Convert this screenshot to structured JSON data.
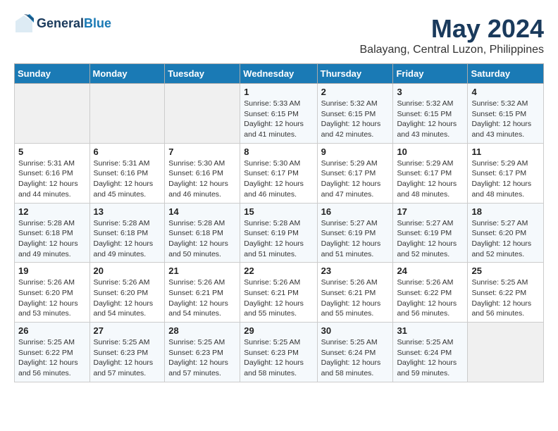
{
  "header": {
    "logo_line1": "General",
    "logo_line2": "Blue",
    "month": "May 2024",
    "location": "Balayang, Central Luzon, Philippines"
  },
  "weekdays": [
    "Sunday",
    "Monday",
    "Tuesday",
    "Wednesday",
    "Thursday",
    "Friday",
    "Saturday"
  ],
  "weeks": [
    [
      {
        "day": "",
        "info": ""
      },
      {
        "day": "",
        "info": ""
      },
      {
        "day": "",
        "info": ""
      },
      {
        "day": "1",
        "info": "Sunrise: 5:33 AM\nSunset: 6:15 PM\nDaylight: 12 hours\nand 41 minutes."
      },
      {
        "day": "2",
        "info": "Sunrise: 5:32 AM\nSunset: 6:15 PM\nDaylight: 12 hours\nand 42 minutes."
      },
      {
        "day": "3",
        "info": "Sunrise: 5:32 AM\nSunset: 6:15 PM\nDaylight: 12 hours\nand 43 minutes."
      },
      {
        "day": "4",
        "info": "Sunrise: 5:32 AM\nSunset: 6:15 PM\nDaylight: 12 hours\nand 43 minutes."
      }
    ],
    [
      {
        "day": "5",
        "info": "Sunrise: 5:31 AM\nSunset: 6:16 PM\nDaylight: 12 hours\nand 44 minutes."
      },
      {
        "day": "6",
        "info": "Sunrise: 5:31 AM\nSunset: 6:16 PM\nDaylight: 12 hours\nand 45 minutes."
      },
      {
        "day": "7",
        "info": "Sunrise: 5:30 AM\nSunset: 6:16 PM\nDaylight: 12 hours\nand 46 minutes."
      },
      {
        "day": "8",
        "info": "Sunrise: 5:30 AM\nSunset: 6:17 PM\nDaylight: 12 hours\nand 46 minutes."
      },
      {
        "day": "9",
        "info": "Sunrise: 5:29 AM\nSunset: 6:17 PM\nDaylight: 12 hours\nand 47 minutes."
      },
      {
        "day": "10",
        "info": "Sunrise: 5:29 AM\nSunset: 6:17 PM\nDaylight: 12 hours\nand 48 minutes."
      },
      {
        "day": "11",
        "info": "Sunrise: 5:29 AM\nSunset: 6:17 PM\nDaylight: 12 hours\nand 48 minutes."
      }
    ],
    [
      {
        "day": "12",
        "info": "Sunrise: 5:28 AM\nSunset: 6:18 PM\nDaylight: 12 hours\nand 49 minutes."
      },
      {
        "day": "13",
        "info": "Sunrise: 5:28 AM\nSunset: 6:18 PM\nDaylight: 12 hours\nand 49 minutes."
      },
      {
        "day": "14",
        "info": "Sunrise: 5:28 AM\nSunset: 6:18 PM\nDaylight: 12 hours\nand 50 minutes."
      },
      {
        "day": "15",
        "info": "Sunrise: 5:28 AM\nSunset: 6:19 PM\nDaylight: 12 hours\nand 51 minutes."
      },
      {
        "day": "16",
        "info": "Sunrise: 5:27 AM\nSunset: 6:19 PM\nDaylight: 12 hours\nand 51 minutes."
      },
      {
        "day": "17",
        "info": "Sunrise: 5:27 AM\nSunset: 6:19 PM\nDaylight: 12 hours\nand 52 minutes."
      },
      {
        "day": "18",
        "info": "Sunrise: 5:27 AM\nSunset: 6:20 PM\nDaylight: 12 hours\nand 52 minutes."
      }
    ],
    [
      {
        "day": "19",
        "info": "Sunrise: 5:26 AM\nSunset: 6:20 PM\nDaylight: 12 hours\nand 53 minutes."
      },
      {
        "day": "20",
        "info": "Sunrise: 5:26 AM\nSunset: 6:20 PM\nDaylight: 12 hours\nand 54 minutes."
      },
      {
        "day": "21",
        "info": "Sunrise: 5:26 AM\nSunset: 6:21 PM\nDaylight: 12 hours\nand 54 minutes."
      },
      {
        "day": "22",
        "info": "Sunrise: 5:26 AM\nSunset: 6:21 PM\nDaylight: 12 hours\nand 55 minutes."
      },
      {
        "day": "23",
        "info": "Sunrise: 5:26 AM\nSunset: 6:21 PM\nDaylight: 12 hours\nand 55 minutes."
      },
      {
        "day": "24",
        "info": "Sunrise: 5:26 AM\nSunset: 6:22 PM\nDaylight: 12 hours\nand 56 minutes."
      },
      {
        "day": "25",
        "info": "Sunrise: 5:25 AM\nSunset: 6:22 PM\nDaylight: 12 hours\nand 56 minutes."
      }
    ],
    [
      {
        "day": "26",
        "info": "Sunrise: 5:25 AM\nSunset: 6:22 PM\nDaylight: 12 hours\nand 56 minutes."
      },
      {
        "day": "27",
        "info": "Sunrise: 5:25 AM\nSunset: 6:23 PM\nDaylight: 12 hours\nand 57 minutes."
      },
      {
        "day": "28",
        "info": "Sunrise: 5:25 AM\nSunset: 6:23 PM\nDaylight: 12 hours\nand 57 minutes."
      },
      {
        "day": "29",
        "info": "Sunrise: 5:25 AM\nSunset: 6:23 PM\nDaylight: 12 hours\nand 58 minutes."
      },
      {
        "day": "30",
        "info": "Sunrise: 5:25 AM\nSunset: 6:24 PM\nDaylight: 12 hours\nand 58 minutes."
      },
      {
        "day": "31",
        "info": "Sunrise: 5:25 AM\nSunset: 6:24 PM\nDaylight: 12 hours\nand 59 minutes."
      },
      {
        "day": "",
        "info": ""
      }
    ]
  ]
}
